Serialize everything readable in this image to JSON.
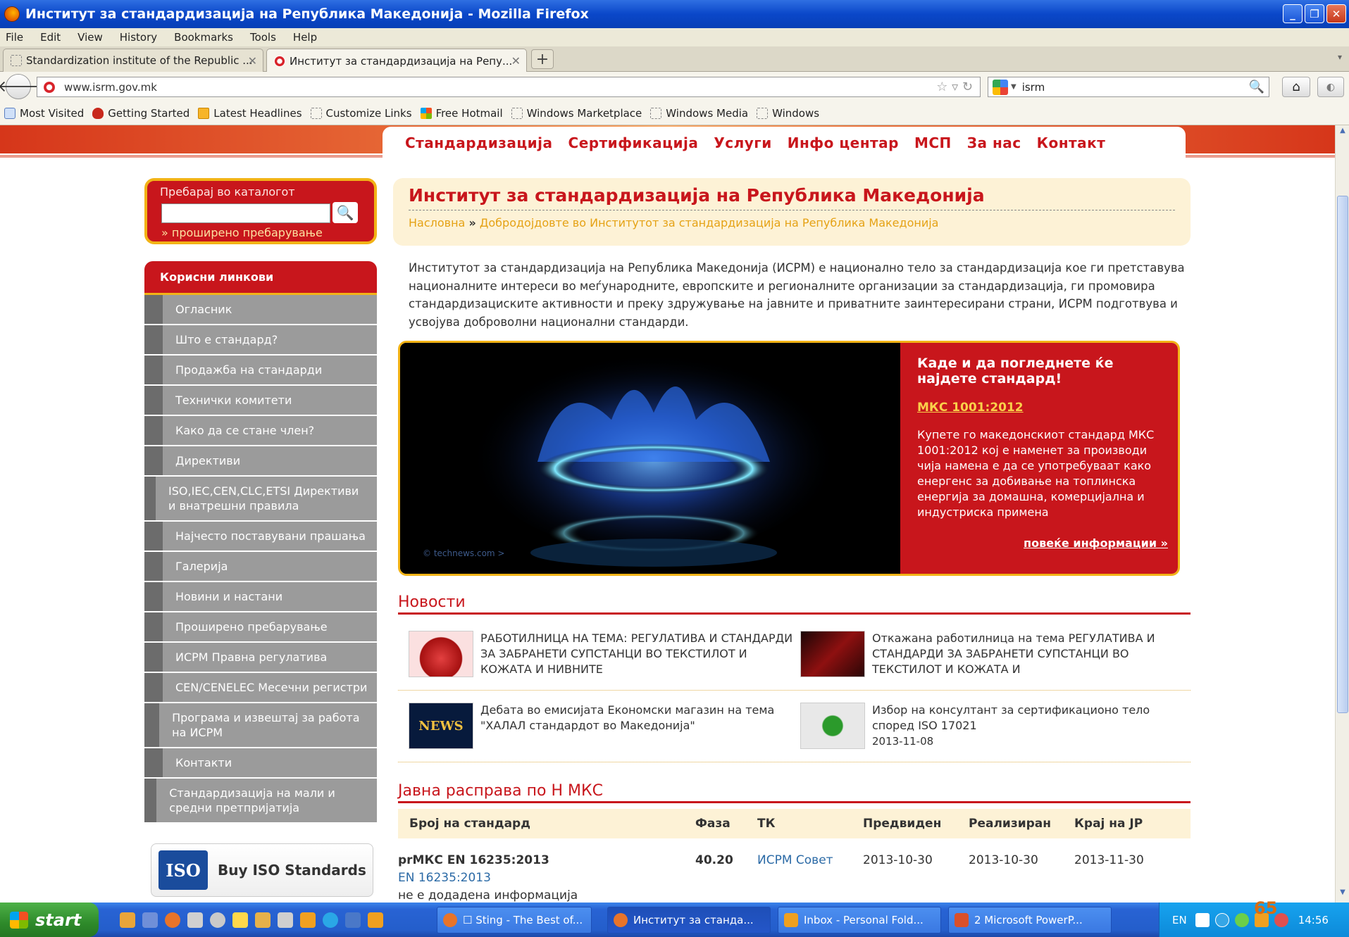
{
  "window": {
    "title": "Институт за стандардизација на Република Македонија - Mozilla Firefox",
    "controls": [
      "_",
      "❐",
      "✕"
    ]
  },
  "menu": [
    "File",
    "Edit",
    "View",
    "History",
    "Bookmarks",
    "Tools",
    "Help"
  ],
  "tabs": [
    {
      "label": "Standardization institute of the Republic ...",
      "active": false
    },
    {
      "label": "Институт за стандардизација на Репу...",
      "active": true
    }
  ],
  "nav": {
    "url": "www.isrm.gov.mk",
    "search_value": "isrm"
  },
  "bookmarks": [
    "Most Visited",
    "Getting Started",
    "Latest Headlines",
    "Customize Links",
    "Free Hotmail",
    "Windows Marketplace",
    "Windows Media",
    "Windows"
  ],
  "site": {
    "nav": [
      "Стандардизација",
      "Сертификација",
      "Услуги",
      "Инфо центар",
      "МСП",
      "За нас",
      "Контакт"
    ],
    "search": {
      "label": "Пребарај во каталогот",
      "button": "🔍",
      "advanced": "» проширено пребарување"
    },
    "links": {
      "heading": "Корисни линкови",
      "items": [
        "Огласник",
        "Што е стандард?",
        "Продажба на стандарди",
        "Технички комитети",
        "Како да се стане член?",
        "Директиви",
        "ISO,IEC,CEN,CLC,ETSI Директиви и внатрешни правила",
        "Најчесто поставувани прашања",
        "Галерија",
        "Новини и настани",
        "Проширено пребарување",
        "ИСРМ Правна регулатива",
        "CEN/CENELEC Месечни регистри",
        "Програма и извештај за работа на ИСРМ",
        "Контакти",
        "Стандардизација на мали и средни претпријатија"
      ]
    },
    "iso_banner": {
      "logo": "ISO",
      "text": "Buy ISO Standards"
    },
    "page_title": "Институт за стандардизација на Република Македонија",
    "breadcrumb": {
      "home": "Насловна",
      "separator": "»",
      "current": "Добродојдовте во Институтот за стандардизација на Република Македонија"
    },
    "intro": "Институтот за стандардизација на Република Македонија (ИСРМ) е национално тело за стандардизација кое ги претставува националните интереси во меѓународните, европските и регионалните организации за стандардизација, ги промовира стандардизациските активности и преку здружување на јавните и приватните заинтересирани страни, ИСРМ подготвува и усвојува доброволни национални стандарди.",
    "hero": {
      "watermark": "© technews.com >",
      "heading": "Каде и да погледнете ќе најдете стандард!",
      "standard": "МКС 1001:2012",
      "text": "Купете го македонскиот стандард МКС 1001:2012 кој е наменет за производи чија намена е да се употребуваат како енергенс за добивање на топлинска енергија за домашна, комерцијална и индустриска примена",
      "more": "повеќе информации »"
    },
    "news": {
      "heading": "Новости",
      "items": [
        {
          "text": "РАБОТИЛНИЦА НА ТЕМА: РЕГУЛАТИВА И СТАНДАРДИ ЗА ЗАБРАНЕТИ СУПСТАНЦИ ВО ТЕКСТИЛОТ И КОЖАТА И НИВНИТЕ",
          "date": ""
        },
        {
          "text": "Откажана работилница на тема РЕГУЛАТИВА И СТАНДАРДИ ЗА ЗАБРАНЕТИ СУПСТАНЦИ ВО ТЕКСТИЛОТ И КОЖАТА И",
          "date": ""
        },
        {
          "text": "Дебата во емисијата Економски магазин на тема \"ХАЛАЛ стандардот во Македонија\"",
          "date": "",
          "thumb_text": "NEWS"
        },
        {
          "text": "Избор на консултант за сертификационо тело според ISO 17021",
          "date": "2013-11-08"
        }
      ]
    },
    "public_debate": {
      "heading": "Јавна расправа по Н МКС",
      "columns": [
        "Број на стандард",
        "Фаза",
        "ТК",
        "Предвиден",
        "Реализиран",
        "Крај на ЈР"
      ],
      "rows": [
        {
          "number": "prМКС EN 16235:2013",
          "en": "EN 16235:2013",
          "note": "не е додадена информација",
          "phase": "40.20",
          "tk": "ИСРМ Совет",
          "planned": "2013-10-30",
          "realized": "2013-10-30",
          "end": "2013-11-30"
        }
      ]
    }
  },
  "taskbar": {
    "start": "start",
    "tasks": [
      {
        "label": "☐ Sting - The Best of...",
        "active": false
      },
      {
        "label": "Институт за станда...",
        "active": true
      },
      {
        "label": "Inbox - Personal Fold...",
        "active": false
      },
      {
        "label": "2 Microsoft PowerP...",
        "active": false
      }
    ],
    "lang": "EN",
    "clock": "14:56"
  },
  "slide_number": "65"
}
